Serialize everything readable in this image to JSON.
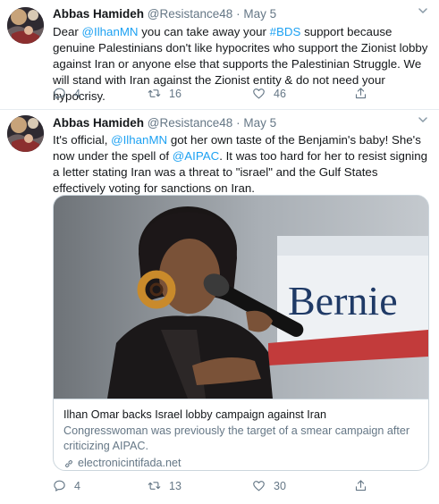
{
  "tweets": [
    {
      "author": {
        "name": "Abbas Hamideh",
        "handle": "@Resistance48",
        "sep": "·",
        "date": "May 5"
      },
      "body": {
        "t1": "Dear ",
        "m1": "@IlhanMN",
        "t2": " you can take away your ",
        "h1": "#BDS",
        "t3": " support because genuine Palestinians don't like hypocrites who support the Zionist lobby against Iran or anyone else that supports the Palestinian Struggle. We will stand with Iran against the Zionist entity & do not need your hypocrisy."
      },
      "stats": {
        "replies": "4",
        "retweets": "16",
        "likes": "46"
      }
    },
    {
      "author": {
        "name": "Abbas Hamideh",
        "handle": "@Resistance48",
        "sep": "·",
        "date": "May 5"
      },
      "body": {
        "t1": "It's official, ",
        "m1": "@IlhanMN",
        "t2": " got her own taste of the Benjamin's baby! She's now under the spell of ",
        "m2": "@AIPAC",
        "t3": ". It was too hard for her to resist signing a letter stating Iran was a threat to \"israel\" and the Gulf States effectively voting for sanctions on Iran."
      },
      "card": {
        "image_sign_text": "Bernie",
        "title": "Ilhan Omar backs Israel lobby campaign against Iran",
        "description": "Congresswoman was previously the target of a smear campaign after criticizing AIPAC.",
        "domain": "electronicintifada.net"
      },
      "stats": {
        "replies": "4",
        "retweets": "13",
        "likes": "30"
      }
    }
  ],
  "colors": {
    "link": "#1da1f2",
    "secondary": "#657786",
    "border": "#e6ecf0",
    "text": "#14171a"
  },
  "icons": [
    "caret-down-icon",
    "reply-icon",
    "retweet-icon",
    "like-icon",
    "share-icon",
    "link-icon"
  ]
}
